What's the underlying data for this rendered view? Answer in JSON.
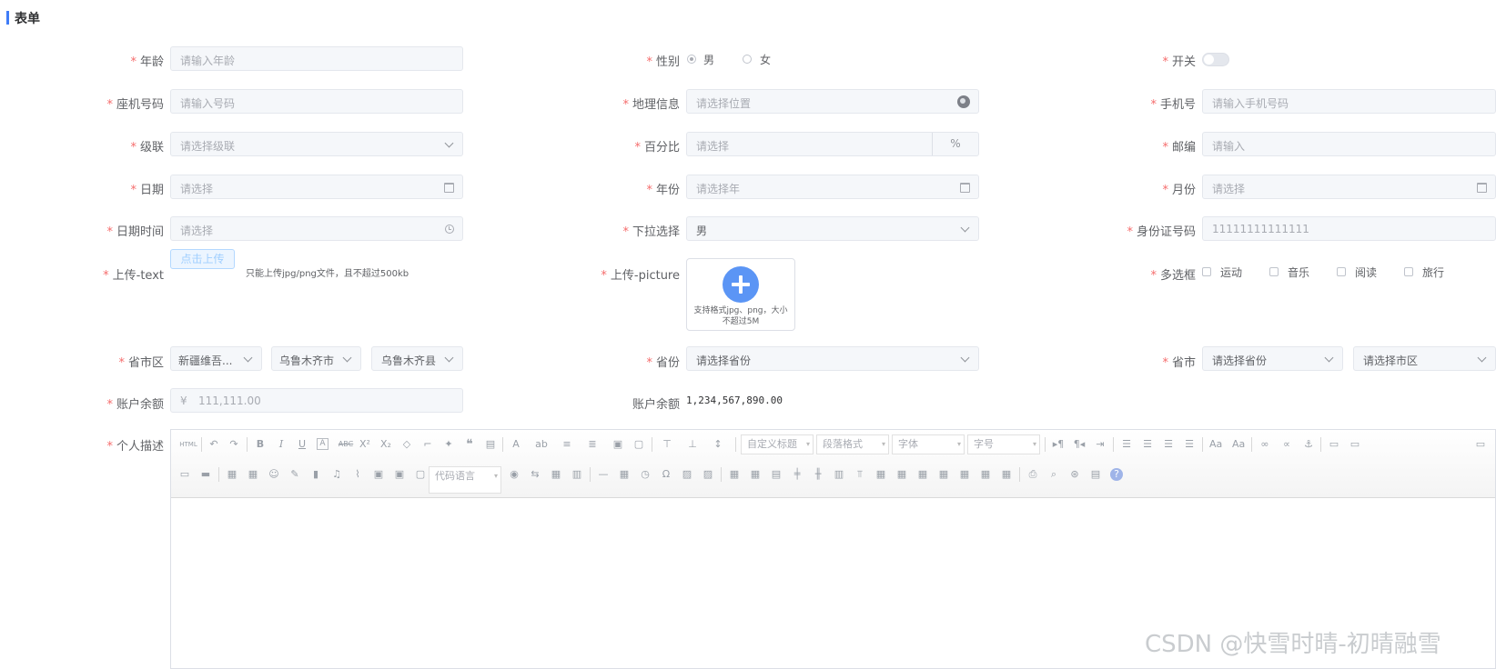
{
  "page": {
    "title": "表单"
  },
  "form": {
    "age": {
      "label": "年龄",
      "placeholder": "请输入年龄"
    },
    "gender": {
      "label": "性别",
      "options": [
        "男",
        "女"
      ],
      "selected": "男"
    },
    "switch": {
      "label": "开关",
      "on": false
    },
    "landline": {
      "label": "座机号码",
      "placeholder": "请输入号码"
    },
    "geo": {
      "label": "地理信息",
      "placeholder": "请选择位置"
    },
    "mobile": {
      "label": "手机号",
      "placeholder": "请输入手机号码"
    },
    "cascade": {
      "label": "级联",
      "placeholder": "请选择级联"
    },
    "percent": {
      "label": "百分比",
      "placeholder": "请选择",
      "suffix": "%"
    },
    "postcode": {
      "label": "邮编",
      "placeholder": "请输入"
    },
    "date": {
      "label": "日期",
      "placeholder": "请选择"
    },
    "year": {
      "label": "年份",
      "placeholder": "请选择年"
    },
    "month": {
      "label": "月份",
      "placeholder": "请选择"
    },
    "datetime": {
      "label": "日期时间",
      "placeholder": "请选择"
    },
    "dropdown": {
      "label": "下拉选择",
      "value": "男"
    },
    "idcard": {
      "label": "身份证号码",
      "value": "11111111111111"
    },
    "upload_text": {
      "label": "上传-text",
      "button": "点击上传",
      "tip": "只能上传jpg/png文件，且不超过500kb"
    },
    "upload_picture": {
      "label": "上传-picture",
      "tip": "支持格式jpg、png，大小不超过5M"
    },
    "checkboxes": {
      "label": "多选框",
      "options": [
        "运动",
        "音乐",
        "阅读",
        "旅行"
      ]
    },
    "region": {
      "label": "省市区",
      "values": [
        "新疆维吾...",
        "乌鲁木齐市",
        "乌鲁木齐县"
      ]
    },
    "province": {
      "label": "省份",
      "placeholder": "请选择省份"
    },
    "province_city": {
      "label": "省市",
      "placeholders": [
        "请选择省份",
        "请选择市区"
      ]
    },
    "balance": {
      "label": "账户余额",
      "prefix": "¥",
      "value": "111,111.00"
    },
    "balance_display": {
      "label": "账户余额",
      "value": "1,234,567,890.00"
    },
    "description": {
      "label": "个人描述",
      "toolbar_selects": [
        "自定义标题",
        "段落格式",
        "字体",
        "字号",
        "代码语言"
      ]
    }
  },
  "watermark": "CSDN @快雪时晴-初晴融雪"
}
